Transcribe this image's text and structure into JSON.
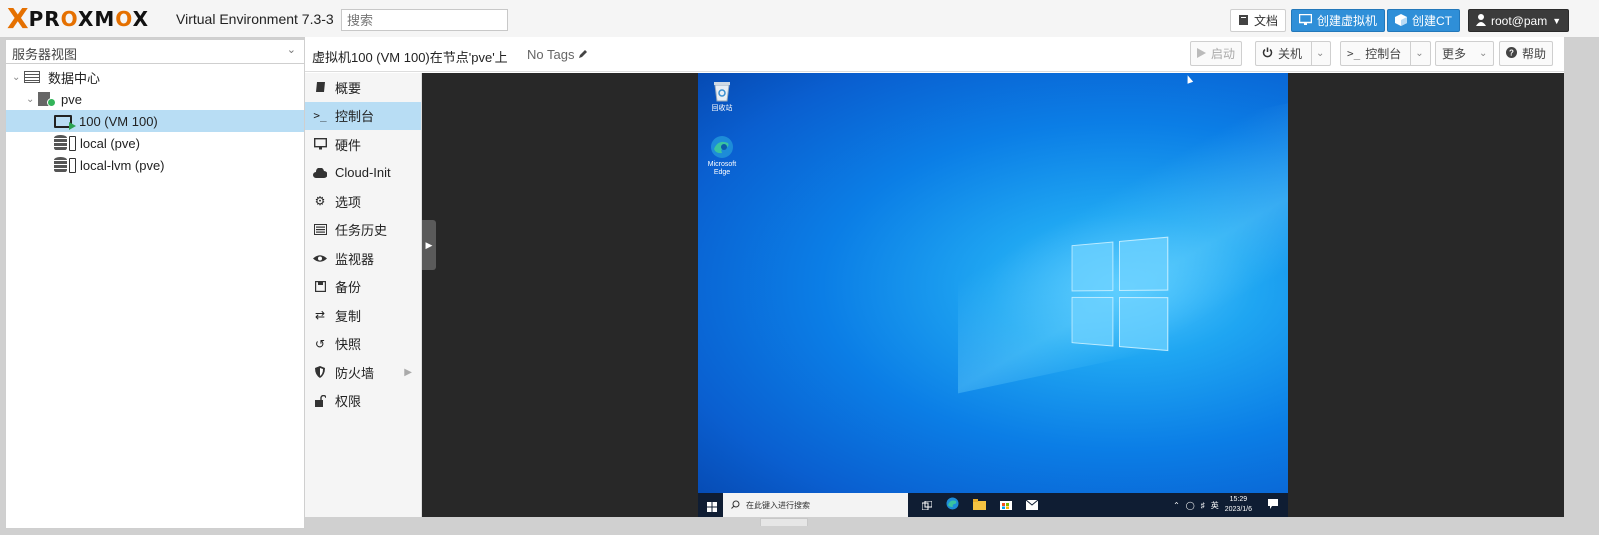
{
  "topbar": {
    "logo_x": "X",
    "logo_word_a": "PR",
    "logo_word_o1": "O",
    "logo_word_b": "XM",
    "logo_word_o2": "O",
    "logo_word_c": "X",
    "version": "Virtual Environment 7.3-3",
    "search_placeholder": "搜索",
    "docs_label": "文档",
    "create_vm_label": "创建虚拟机",
    "create_ct_label": "创建CT",
    "user_label": "root@pam"
  },
  "left": {
    "view_selector": "服务器视图",
    "tree": [
      {
        "label": "数据中心"
      },
      {
        "label": "pve"
      },
      {
        "label": "100 (VM 100)"
      },
      {
        "label": "local (pve)"
      },
      {
        "label": "local-lvm (pve)"
      }
    ]
  },
  "header": {
    "title": "虚拟机100 (VM 100)在节点'pve'上",
    "tags": "No Tags",
    "start_label": "启动",
    "shutdown_label": "关机",
    "console_label": "控制台",
    "more_label": "更多",
    "help_label": "帮助"
  },
  "menu": [
    {
      "label": "概要"
    },
    {
      "label": "控制台"
    },
    {
      "label": "硬件"
    },
    {
      "label": "Cloud-Init"
    },
    {
      "label": "选项"
    },
    {
      "label": "任务历史"
    },
    {
      "label": "监视器"
    },
    {
      "label": "备份"
    },
    {
      "label": "复制"
    },
    {
      "label": "快照"
    },
    {
      "label": "防火墙"
    },
    {
      "label": "权限"
    }
  ],
  "console": {
    "desktop_icons": [
      {
        "label": "回收站"
      },
      {
        "label": "Microsoft Edge"
      }
    ],
    "taskbar_search": "在此键入进行搜索",
    "tray_lang": "英",
    "clock_time": "15:29",
    "clock_date": "2023/1/6"
  },
  "colors": {
    "accent_blue": "#2f8fd8",
    "selected_row": "#b8ddf4",
    "proxmox_orange": "#e57000"
  }
}
